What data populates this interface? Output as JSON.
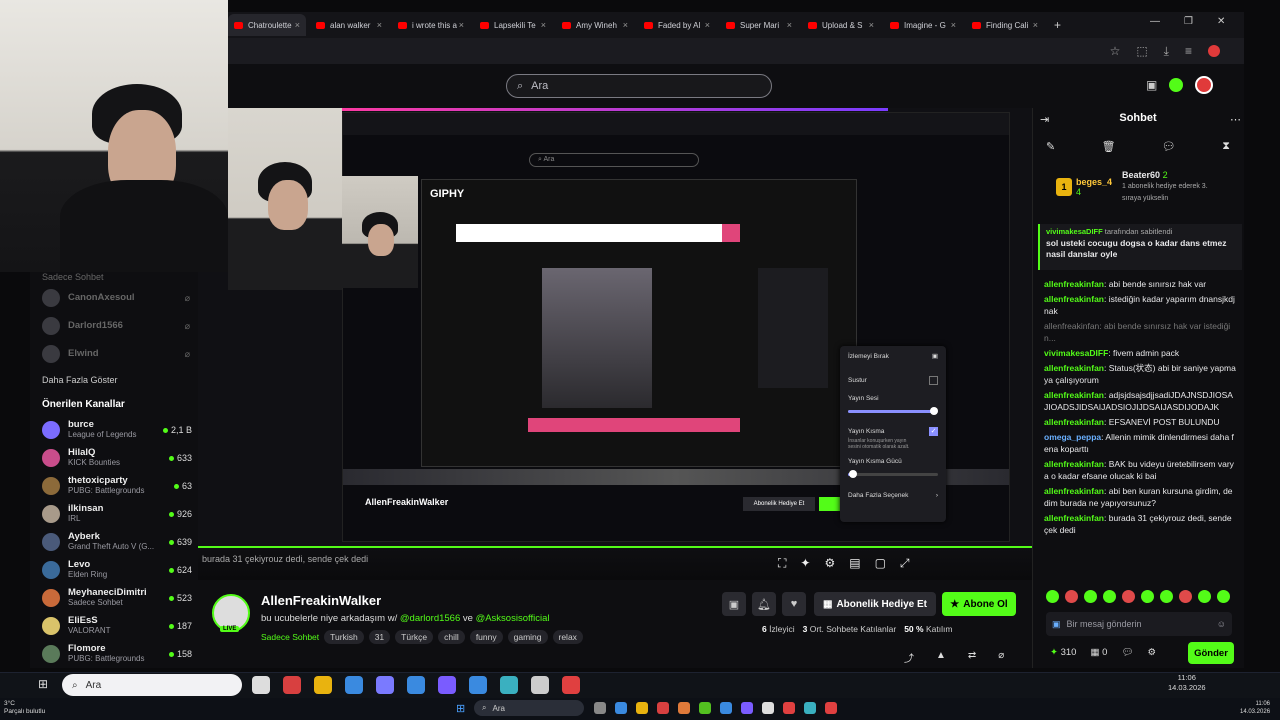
{
  "browser": {
    "tabs": [
      {
        "label": "Chatroulette",
        "active": true
      },
      {
        "label": "alan walker"
      },
      {
        "label": "i wrote this a"
      },
      {
        "label": "Lapsekili Te"
      },
      {
        "label": "Amy Wineh"
      },
      {
        "label": "Faded by Al"
      },
      {
        "label": "Super Mari"
      },
      {
        "label": "Upload & S"
      },
      {
        "label": "Imagine - G"
      },
      {
        "label": "Finding Cali"
      }
    ],
    "new_tab": "+"
  },
  "header": {
    "search_placeholder": "Ara"
  },
  "sidebar": {
    "top_label": "Sadece Sohbet",
    "followed": [
      "CanonAxesoul",
      "Darlord1566",
      "Elwind"
    ],
    "show_more": "Daha Fazla Göster",
    "recommended_title": "Önerilen Kanallar",
    "channels": [
      {
        "name": "burce",
        "category": "League of Legends",
        "viewers": "2,1 B",
        "color": "#7b6cff"
      },
      {
        "name": "HilalQ",
        "category": "KICK Bounties",
        "viewers": "633",
        "color": "#c94d8b"
      },
      {
        "name": "thetoxicparty",
        "category": "PUBG: Battlegrounds",
        "viewers": "63",
        "color": "#8c6a3a"
      },
      {
        "name": "ilkinsan",
        "category": "IRL",
        "viewers": "926",
        "color": "#a89a8a"
      },
      {
        "name": "Ayberk",
        "category": "Grand Theft Auto V (G...",
        "viewers": "639",
        "color": "#4a5a7a"
      },
      {
        "name": "Levo",
        "category": "Elden Ring",
        "viewers": "624",
        "color": "#3a6a9a"
      },
      {
        "name": "MeyhaneciDimitri",
        "category": "Sadece Sohbet",
        "viewers": "523",
        "color": "#c96a3a"
      },
      {
        "name": "EliEsS",
        "category": "VALORANT",
        "viewers": "187",
        "color": "#d9c36a"
      },
      {
        "name": "Flomore",
        "category": "PUBG: Battlegrounds",
        "viewers": "158",
        "color": "#5a7a5a"
      }
    ]
  },
  "video": {
    "inner_site_logo": "GIPHY",
    "inner_search_placeholder": "Ara",
    "inner_channel": "AllenFreakinWalker",
    "caption_overlay": "burada 31 çekiyrouz dedi, sende çek dedi"
  },
  "settings_popup": {
    "title": "İzlemeyi Bırak",
    "mute": "Sustur",
    "volume": "Yayın Sesi",
    "volume_level": 0.95,
    "ducking": "Yayın Kısma",
    "ducking_desc": "İnsanlar konuşurken yayın sesini otomatik olarak azalt.",
    "ducking_strength": "Yayın Kısma Gücü",
    "ducking_level": 0.05,
    "more": "Daha Fazla Seçenek"
  },
  "stream": {
    "streamer": "AllenFreakinWalker",
    "live": "LIVE",
    "title_prefix": "bu ucubelerle niye arkadaşım w/",
    "mention1": "@darlord1566",
    "and": "ve",
    "mention2": "@Asksosisofficial",
    "category": "Sadece Sohbet",
    "tags": [
      "Turkish",
      "31",
      "Türkçe",
      "chill",
      "funny",
      "gaming",
      "relax"
    ],
    "gift_button": "Abonelik Hediye Et",
    "subscribe_button": "Abone Ol",
    "viewers": "6",
    "viewers_label": "İzleyici",
    "avg_chatters": "3",
    "avg_chatters_label": "Ort. Sohbete Katılanlar",
    "participation": "50 %",
    "participation_label": "Katılım"
  },
  "chat": {
    "title": "Sohbet",
    "top_gifter1": {
      "name": "beges_4",
      "count": "4"
    },
    "top_gifter2": {
      "name": "Beater60",
      "count": "2",
      "note": "1 abonelik hediye ederek 3. sıraya yükselin"
    },
    "pinned_by": "vivimakesaDIFF",
    "pinned_suffix": "tarafından sabitlendi",
    "pinned_text": "sol usteki cocugu dogsa o kadar dans etmez nasil danslar oyle",
    "messages": [
      {
        "user": "allenfreakinfan",
        "text": "abi bende sınırsız hak var"
      },
      {
        "user": "allenfreakinfan",
        "text": "istediğin kadar yaparım dnansjkdjnak"
      },
      {
        "user": "allenfreakinfan",
        "text": "abi bende sınırsız hak var istediğin...",
        "faded": true
      },
      {
        "user": "vivimakesaDIFF",
        "text": "fivem admin pack"
      },
      {
        "user": "allenfreakinfan",
        "text": "Status(状态) abi bir saniye yapmaya çalışıyorum"
      },
      {
        "user": "allenfreakinfan",
        "text": "adjsjdsajsdjjsadiJDAJNSDJIOSAJIOADSJIDSAIJADSIOJIJDSAIJASDIJODAJK"
      },
      {
        "user": "allenfreakinfan",
        "text": "EFSANEVİ POST BULUNDU"
      },
      {
        "user": "omega_peppa",
        "text": "Allenin mimik dinlendirmesi daha fena koparttı",
        "alt": true
      },
      {
        "user": "allenfreakinfan",
        "text": "BAK bu videyu üretebilirsem varya o kadar efsane olucak ki bai"
      },
      {
        "user": "allenfreakinfan",
        "text": "abi ben kuran kursuna girdim, dedim burada ne yapıyorsunuz?"
      },
      {
        "user": "allenfreakinfan",
        "text": "burada 31 çekiyrouz dedi, sende çek dedi"
      }
    ],
    "input_placeholder": "Bir mesaj gönderin",
    "points": "310",
    "zero": "0",
    "send_button": "Gönder"
  },
  "taskbar": {
    "search_placeholder": "Ara",
    "time": "11:06",
    "date": "14.03.2026",
    "search2_placeholder": "Ara",
    "time2": "11:06",
    "date2": "14.03.2026",
    "weather_temp": "3°C",
    "weather_desc": "Parçalı bulutlu"
  },
  "colors": {
    "accent": "#53fc18",
    "bg": "#0e0e11"
  }
}
